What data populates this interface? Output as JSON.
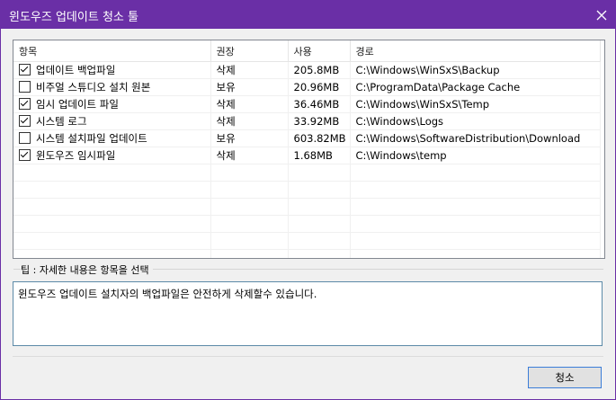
{
  "window": {
    "title": "윈도우즈 업데이트 청소 툴"
  },
  "list": {
    "headers": [
      "항목",
      "권장",
      "사용",
      "경로"
    ],
    "rows": [
      {
        "checked": true,
        "name": "업데이트 백업파일",
        "rec": "삭제",
        "size": "205.8MB",
        "path": "C:\\Windows\\WinSxS\\Backup"
      },
      {
        "checked": false,
        "name": "비주얼 스튜디오 설치 원본",
        "rec": "보유",
        "size": "20.96MB",
        "path": "C:\\ProgramData\\Package Cache"
      },
      {
        "checked": true,
        "name": "임시 업데이트 파일",
        "rec": "삭제",
        "size": "36.46MB",
        "path": "C:\\Windows\\WinSxS\\Temp"
      },
      {
        "checked": true,
        "name": "시스템 로그",
        "rec": "삭제",
        "size": "33.92MB",
        "path": "C:\\Windows\\Logs"
      },
      {
        "checked": false,
        "name": "시스템 설치파일 업데이트",
        "rec": "보유",
        "size": "603.82MB",
        "path": "C:\\Windows\\SoftwareDistribution\\Download"
      },
      {
        "checked": true,
        "name": "윈도우즈 임시파일",
        "rec": "삭제",
        "size": "1.68MB",
        "path": "C:\\Windows\\temp"
      }
    ]
  },
  "tip": {
    "label": "팁 : 자세한 내용은 항목을 선택",
    "text": "윈도우즈 업데이트 설치자의 백업파일은 안전하게 삭제할수 있습니다."
  },
  "actions": {
    "clean_label": "청소"
  },
  "colors": {
    "titlebar": "#6a2fa6",
    "accent": "#3b7dd8"
  }
}
